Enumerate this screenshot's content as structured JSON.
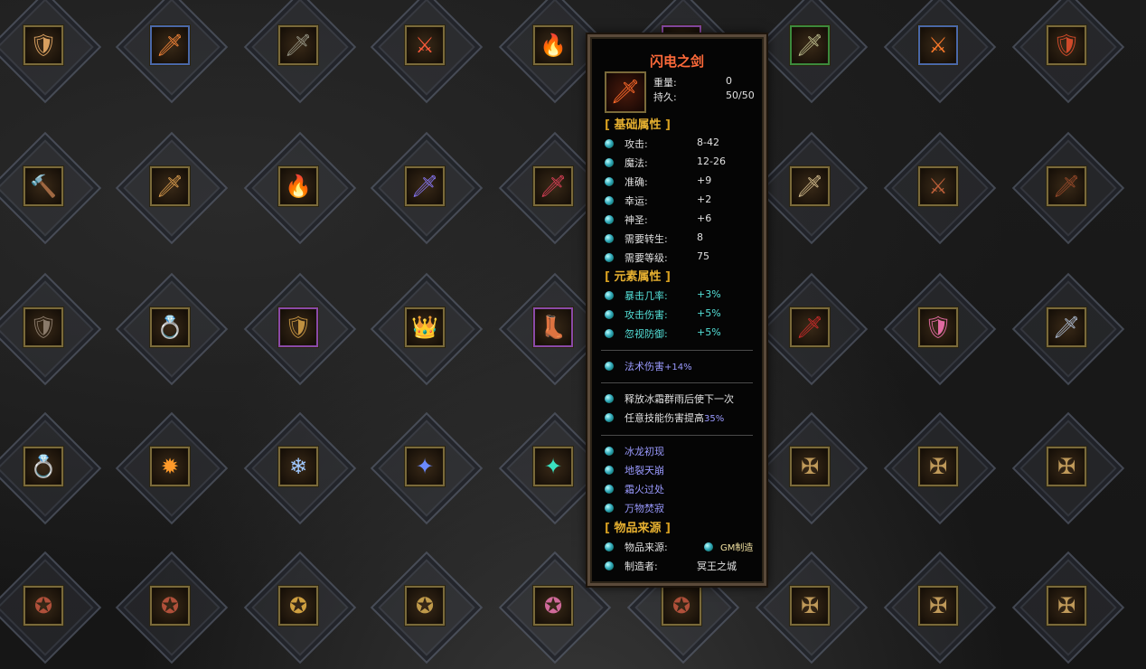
{
  "colors": {
    "title": "#ff6a3a",
    "section": "#e6b030",
    "cyan_stat": "#54e0d8",
    "blue_stat": "#9a9aff",
    "frame_gold": "#7a6a3a"
  },
  "grid": {
    "rows": [
      [
        {
          "icon": "armored-warrior-icon",
          "glyph": "🛡",
          "color": "#d9a060",
          "frame": ""
        },
        {
          "icon": "flame-sword-icon",
          "glyph": "🗡",
          "color": "#ff8a3a",
          "frame": "blue"
        },
        {
          "icon": "dark-sword-icon",
          "glyph": "🗡",
          "color": "#9a9a8a",
          "frame": ""
        },
        {
          "icon": "curved-blade-icon",
          "glyph": "⚔",
          "color": "#ff5a3a",
          "frame": ""
        },
        {
          "icon": "fire-sword-icon",
          "glyph": "🔥",
          "color": "#ff6a2a",
          "frame": ""
        },
        {
          "icon": "hidden-slot",
          "glyph": "",
          "color": "#000",
          "frame": "purple"
        },
        {
          "icon": "jade-sword-icon",
          "glyph": "🗡",
          "color": "#c0c090",
          "frame": "green"
        },
        {
          "icon": "flame-blade-icon",
          "glyph": "⚔",
          "color": "#ff7a2a",
          "frame": "blue"
        },
        {
          "icon": "red-armor-icon",
          "glyph": "🛡",
          "color": "#d04a2a",
          "frame": ""
        }
      ],
      [
        {
          "icon": "golden-club-icon",
          "glyph": "🔨",
          "color": "#c08a3a",
          "frame": ""
        },
        {
          "icon": "ornate-sword-icon",
          "glyph": "🗡",
          "color": "#e0a050",
          "frame": ""
        },
        {
          "icon": "fire-blade-icon",
          "glyph": "🔥",
          "color": "#ff7a1a",
          "frame": ""
        },
        {
          "icon": "crystal-sword-icon",
          "glyph": "🗡",
          "color": "#8a7aff",
          "frame": ""
        },
        {
          "icon": "crimson-sword-icon",
          "glyph": "🗡",
          "color": "#e0405a",
          "frame": ""
        },
        {
          "icon": "hidden-slot",
          "glyph": "",
          "color": "#000",
          "frame": ""
        },
        {
          "icon": "bone-sword-icon",
          "glyph": "🗡",
          "color": "#d8c090",
          "frame": ""
        },
        {
          "icon": "demon-blade-icon",
          "glyph": "⚔",
          "color": "#c0603a",
          "frame": ""
        },
        {
          "icon": "dark-blade-icon",
          "glyph": "🗡",
          "color": "#9a4a2a",
          "frame": ""
        }
      ],
      [
        {
          "icon": "dark-armor-icon",
          "glyph": "🛡",
          "color": "#8a7a6a",
          "frame": ""
        },
        {
          "icon": "ring-icon",
          "glyph": "💍",
          "color": "#d0b070",
          "frame": ""
        },
        {
          "icon": "gold-armor-icon",
          "glyph": "🛡",
          "color": "#c09040",
          "frame": "purple"
        },
        {
          "icon": "crown-icon",
          "glyph": "👑",
          "color": "#e0b050",
          "frame": ""
        },
        {
          "icon": "boots-icon",
          "glyph": "👢",
          "color": "#b07040",
          "frame": "purple"
        },
        {
          "icon": "hidden-slot",
          "glyph": "",
          "color": "#000",
          "frame": ""
        },
        {
          "icon": "red-dagger-icon",
          "glyph": "🗡",
          "color": "#d02a2a",
          "frame": ""
        },
        {
          "icon": "pink-armor-icon",
          "glyph": "🛡",
          "color": "#e06aa0",
          "frame": ""
        },
        {
          "icon": "steel-sword-icon",
          "glyph": "🗡",
          "color": "#b0c0d8",
          "frame": ""
        }
      ],
      [
        {
          "icon": "ruby-bracelet-icon",
          "glyph": "💍",
          "color": "#d03a3a",
          "frame": ""
        },
        {
          "icon": "fire-gem-icon",
          "glyph": "✹",
          "color": "#ff9a2a",
          "frame": ""
        },
        {
          "icon": "ice-shard-icon",
          "glyph": "❄",
          "color": "#a0c8ff",
          "frame": ""
        },
        {
          "icon": "blue-orb-icon",
          "glyph": "✦",
          "color": "#6a8aff",
          "frame": ""
        },
        {
          "icon": "jade-gem-icon",
          "glyph": "✦",
          "color": "#3ae0c0",
          "frame": ""
        },
        {
          "icon": "hidden-slot",
          "glyph": "",
          "color": "#000",
          "frame": ""
        },
        {
          "icon": "bronze-emblem-icon",
          "glyph": "✠",
          "color": "#c09a5a",
          "frame": ""
        },
        {
          "icon": "bronze-emblem-icon",
          "glyph": "✠",
          "color": "#c09a5a",
          "frame": ""
        },
        {
          "icon": "bronze-emblem-icon",
          "glyph": "✠",
          "color": "#c09a5a",
          "frame": ""
        }
      ],
      [
        {
          "icon": "red-emblem-icon",
          "glyph": "✪",
          "color": "#b0503a",
          "frame": ""
        },
        {
          "icon": "red-emblem-icon",
          "glyph": "✪",
          "color": "#b0503a",
          "frame": ""
        },
        {
          "icon": "gold-emblem-icon",
          "glyph": "✪",
          "color": "#d0a040",
          "frame": ""
        },
        {
          "icon": "gold-emblem-icon",
          "glyph": "✪",
          "color": "#c09a4a",
          "frame": ""
        },
        {
          "icon": "pink-emblem-icon",
          "glyph": "✪",
          "color": "#d06a9a",
          "frame": ""
        },
        {
          "icon": "red-emblem-icon",
          "glyph": "✪",
          "color": "#b0503a",
          "frame": ""
        },
        {
          "icon": "bronze-emblem-icon",
          "glyph": "✠",
          "color": "#c09a5a",
          "frame": ""
        },
        {
          "icon": "bronze-emblem-icon",
          "glyph": "✠",
          "color": "#c09a5a",
          "frame": ""
        },
        {
          "icon": "bronze-emblem-icon",
          "glyph": "✠",
          "color": "#c09a5a",
          "frame": ""
        }
      ]
    ]
  },
  "tooltip": {
    "title": "闪电之剑",
    "icon": "lightning-sword-icon",
    "weight_label": "重量:",
    "weight_value": "0",
    "durability_label": "持久:",
    "durability_value": "50/50",
    "section_base": "基础属性",
    "base_stats": [
      {
        "label": "攻击:",
        "value": "8-42"
      },
      {
        "label": "魔法:",
        "value": "12-26"
      },
      {
        "label": "准确:",
        "value": "+9"
      },
      {
        "label": "幸运:",
        "value": "+2"
      },
      {
        "label": "神圣:",
        "value": "+6"
      },
      {
        "label": "需要转生:",
        "value": "8"
      },
      {
        "label": "需要等级:",
        "value": "75"
      }
    ],
    "section_element": "元素属性",
    "element_stats": [
      {
        "label": "暴击几率:",
        "value": "+3%"
      },
      {
        "label": "攻击伤害:",
        "value": "+5%"
      },
      {
        "label": "忽视防御:",
        "value": "+5%"
      }
    ],
    "spell_label": "法术伤害",
    "spell_value": "+14%",
    "effect_1": "释放冰霜群雨后使下一次",
    "effect_2_text": "任意技能伤害提高",
    "effect_2_value": "35%",
    "skills": [
      "冰龙初现",
      "地裂天崩",
      "霜火过处",
      "万物焚寂"
    ],
    "section_source": "物品来源",
    "source_label": "物品来源:",
    "source_value": "GM制造",
    "maker_label": "制造者:",
    "maker_value": "冥王之城"
  }
}
